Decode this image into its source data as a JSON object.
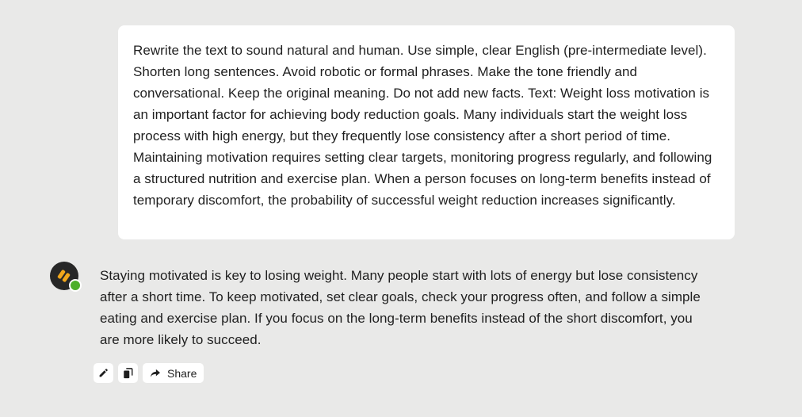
{
  "user_message": {
    "text": "Rewrite the text to sound natural and human. Use simple, clear English (pre-intermediate level). Shorten long sentences. Avoid robotic or formal phrases. Make the tone friendly and conversational. Keep the original meaning. Do not add new facts. Text: Weight loss motivation is an important factor for achieving body reduction goals. Many individuals start the weight loss process with high energy, but they frequently lose consistency after a short period of time. Maintaining motivation requires setting clear targets, monitoring progress regularly, and following a structured nutrition and exercise plan. When a person focuses on long-term benefits instead of temporary discomfort, the probability of successful weight reduction increases significantly."
  },
  "assistant_message": {
    "avatar_icon": "assistant-logo-icon",
    "status_color": "#4caf2a",
    "text": "Staying motivated is key to losing weight. Many people start with lots of energy but lose consistency after a short time. To keep motivated, set clear goals, check your progress often, and follow a simple eating and exercise plan. If you focus on the long-term benefits instead of the short discomfort, you are more likely to succeed."
  },
  "actions": {
    "edit_icon": "pencil-icon",
    "copy_icon": "copy-icon",
    "share_icon": "share-arrow-icon",
    "share_label": "Share"
  }
}
